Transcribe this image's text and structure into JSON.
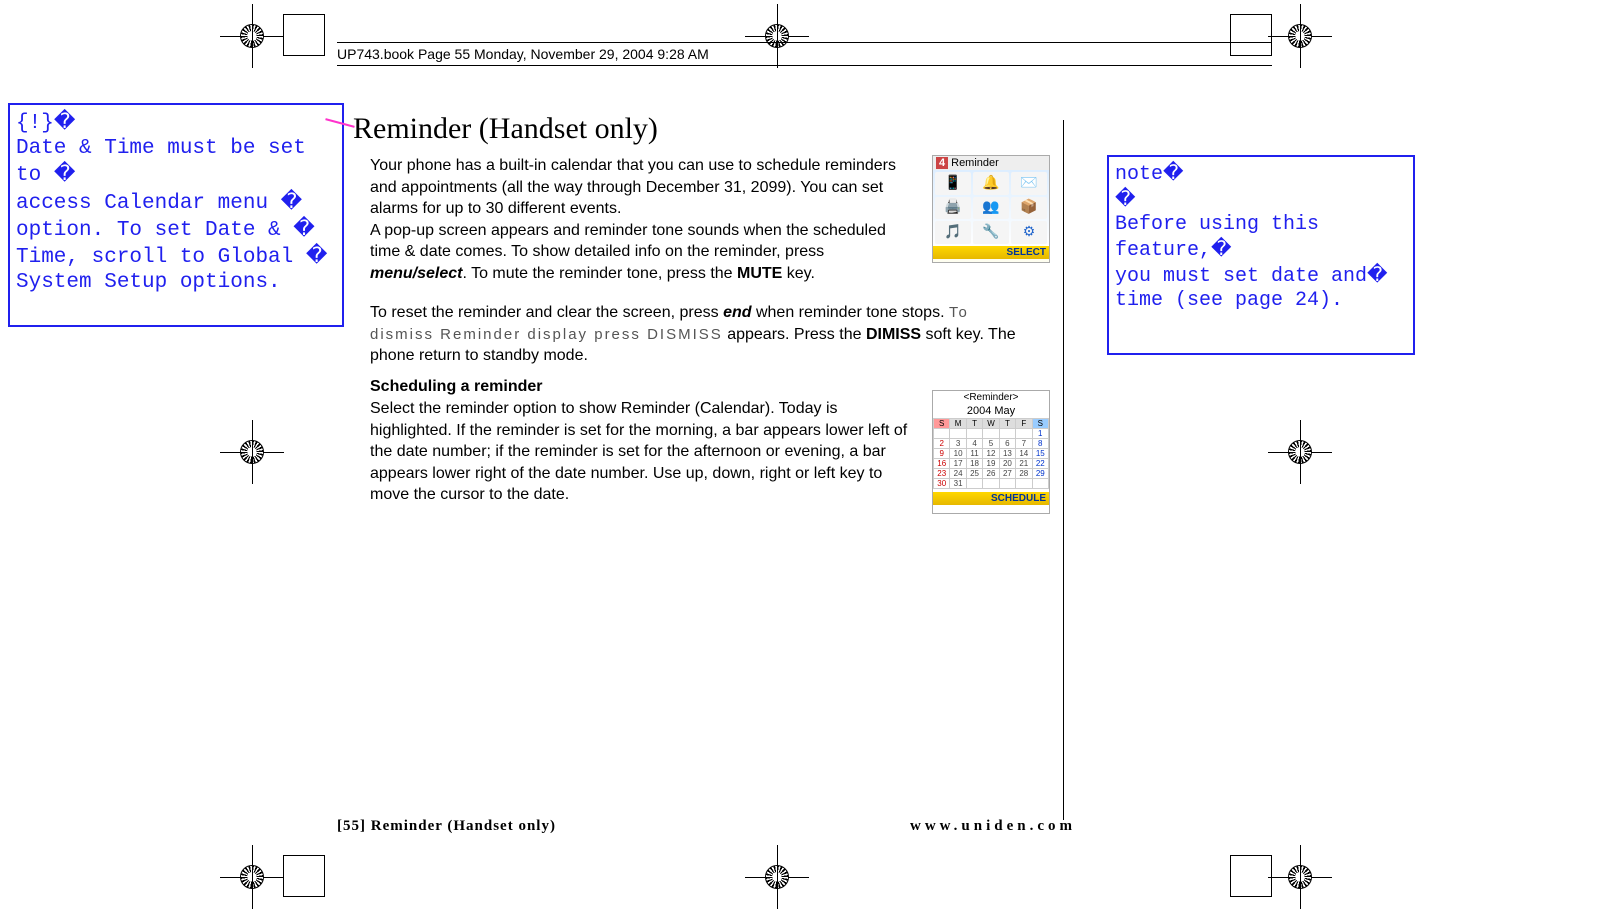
{
  "header": "UP743.book  Page 55  Monday, November 29, 2004  9:28 AM",
  "left_annot": {
    "line1": "{!}",
    "line2": "Date & Time must be set to ",
    "line3": "access Calendar menu ",
    "line4": "option. To set Date & ",
    "line5": "Time, scroll to Global ",
    "line6": "System Setup options."
  },
  "right_annot": {
    "line1": "note",
    "line2": "",
    "line3": "Before using this feature,",
    "line4": "you must set date and",
    "line5": "time (see page 24)."
  },
  "title": "Reminder (Handset only)",
  "body": {
    "p1a": "Your phone has a built-in calendar that you can use to schedule reminders and appointments (all the way through December 31, 2099). You can set alarms for up to 30 different events.",
    "p1b_pre": "A pop-up screen appears and reminder tone sounds when the scheduled time & date comes. To show detailed info on the reminder, press ",
    "p1b_em": "menu/select",
    "p1b_mid": ". To mute the reminder tone, press the ",
    "p1b_b": "MUTE",
    "p1b_post": " key.",
    "p2_pre": "To reset the reminder and clear the screen, press ",
    "p2_em": "end",
    "p2_mid": " when reminder tone stops. ",
    "p2_lcd": "To dismiss Reminder display press DISMISS",
    "p2_post1": " appears. Press the ",
    "p2_b": "DIMISS",
    "p2_post2": " soft key. The phone return to standby mode.",
    "subhead": "Scheduling a reminder",
    "p3": "Select the reminder option to show Reminder (Calendar). Today is highlighted. If the reminder is set for the morning, a bar appears lower left of the date number; if the reminder is set for the afternoon or evening, a bar appears lower right of the date number. Use up, down, right or left key to move the cursor to the date."
  },
  "lcd1": {
    "num": "4",
    "title": "Reminder",
    "softkey": "SELECT"
  },
  "lcd2": {
    "title": "<Reminder>",
    "month": "2004 May",
    "days": [
      "S",
      "M",
      "T",
      "W",
      "T",
      "F",
      "S"
    ],
    "weeks": [
      [
        "",
        "",
        "",
        "",
        "",
        "",
        "1"
      ],
      [
        "2",
        "3",
        "4",
        "5",
        "6",
        "7",
        "8"
      ],
      [
        "9",
        "10",
        "11",
        "12",
        "13",
        "14",
        "15"
      ],
      [
        "16",
        "17",
        "18",
        "19",
        "20",
        "21",
        "22"
      ],
      [
        "23",
        "24",
        "25",
        "26",
        "27",
        "28",
        "29"
      ],
      [
        "30",
        "31",
        "",
        "",
        "",
        "",
        ""
      ]
    ],
    "softkey": "SCHEDULE"
  },
  "footer": {
    "left": "[55] Reminder (Handset only)",
    "right": "www.uniden.com"
  }
}
